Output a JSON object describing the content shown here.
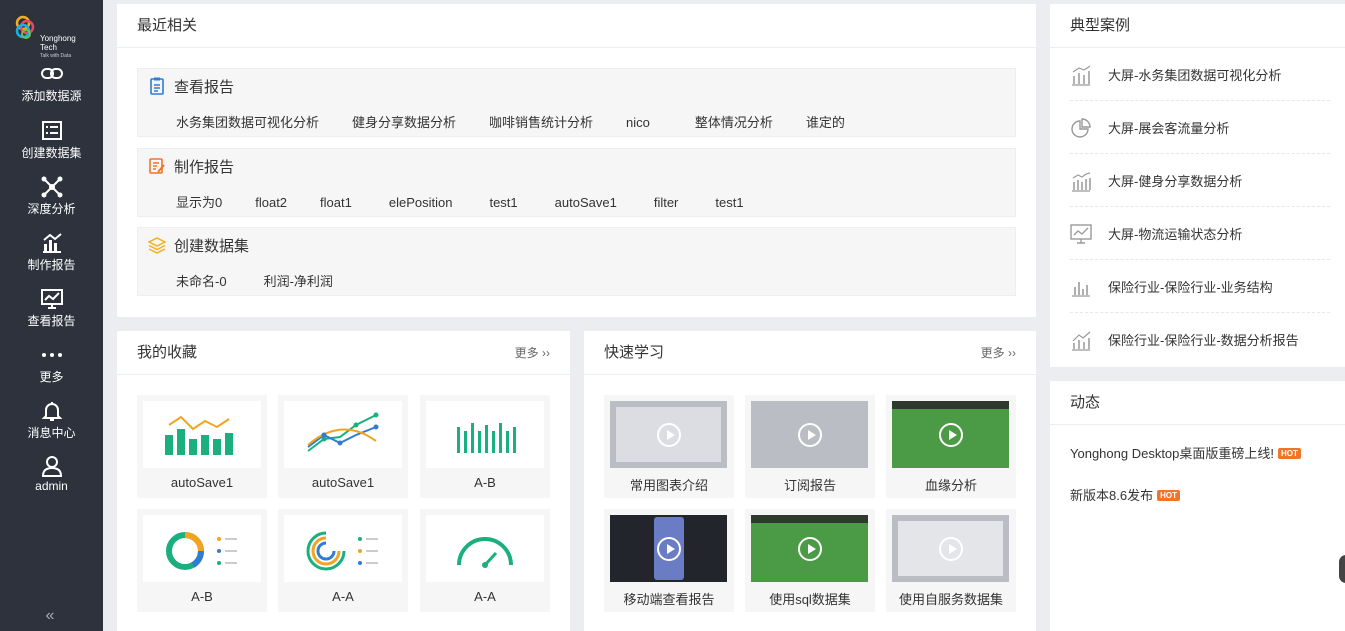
{
  "sidebar": {
    "logo": {
      "brand": "Yonghong Tech",
      "tagline": "Talk with Data"
    },
    "items": [
      {
        "label": "添加数据源",
        "icon": "link-icon"
      },
      {
        "label": "创建数据集",
        "icon": "dataset-icon"
      },
      {
        "label": "深度分析",
        "icon": "network-icon"
      },
      {
        "label": "制作报告",
        "icon": "chart-edit-icon"
      },
      {
        "label": "查看报告",
        "icon": "monitor-chart-icon"
      },
      {
        "label": "更多",
        "icon": "more-dots-icon"
      },
      {
        "label": "消息中心",
        "icon": "bell-icon"
      },
      {
        "label": "admin",
        "icon": "user-icon"
      }
    ],
    "collapse_glyph": "«"
  },
  "recent": {
    "title": "最近相关",
    "groups": [
      {
        "title": "查看报告",
        "icon": "clipboard-icon",
        "color": "#2f7bd6",
        "links": [
          "水务集团数据可视化分析",
          "健身分享数据分析",
          "咖啡销售统计分析",
          "nico",
          "整体情况分析",
          "谁定的"
        ]
      },
      {
        "title": "制作报告",
        "icon": "edit-report-icon",
        "color": "#f07528",
        "links": [
          "显示为0",
          "float2",
          "float1",
          "elePosition",
          "test1",
          "autoSave1",
          "filter",
          "test1"
        ]
      },
      {
        "title": "创建数据集",
        "icon": "layers-icon",
        "color": "#f2b01e",
        "links": [
          "未命名-0",
          "利润-净利润"
        ]
      }
    ]
  },
  "favorites": {
    "title": "我的收藏",
    "more_label": "更多",
    "items": [
      {
        "label": "autoSave1",
        "icon": "bar-line-chart-icon"
      },
      {
        "label": "autoSave1",
        "icon": "multi-line-chart-icon"
      },
      {
        "label": "A-B",
        "icon": "bar-chart-icon"
      },
      {
        "label": "A-B",
        "icon": "donut-chart-icon"
      },
      {
        "label": "A-A",
        "icon": "ring-chart-icon"
      },
      {
        "label": "A-A",
        "icon": "gauge-chart-icon"
      }
    ]
  },
  "learning": {
    "title": "快速学习",
    "more_label": "更多",
    "items": [
      {
        "label": "常用图表介绍",
        "style": "gray"
      },
      {
        "label": "订阅报告",
        "style": "gray"
      },
      {
        "label": "血缘分析",
        "style": "green"
      },
      {
        "label": "移动端查看报告",
        "style": "dark"
      },
      {
        "label": "使用sql数据集",
        "style": "green"
      },
      {
        "label": "使用自服务数据集",
        "style": "gray"
      }
    ]
  },
  "cases": {
    "title": "典型案例",
    "items": [
      {
        "label": "大屏-水务集团数据可视化分析",
        "icon": "bar-trend-icon"
      },
      {
        "label": "大屏-展会客流量分析",
        "icon": "pie-icon"
      },
      {
        "label": "大屏-健身分享数据分析",
        "icon": "bar-trend-icon"
      },
      {
        "label": "大屏-物流运输状态分析",
        "icon": "monitor-chart-icon"
      },
      {
        "label": "保险行业-保险行业-业务结构",
        "icon": "bar-icon"
      },
      {
        "label": "保险行业-保险行业-数据分析报告",
        "icon": "bar-trend-icon"
      }
    ]
  },
  "news": {
    "title": "动态",
    "items": [
      {
        "label": "Yonghong Desktop桌面版重磅上线!",
        "badge": "HOT"
      },
      {
        "label": "新版本8.6发布",
        "badge": "HOT"
      }
    ]
  },
  "colors": {
    "sidebar": "#2d323d",
    "accent_green": "#19b07d",
    "hot": "#f07528"
  }
}
